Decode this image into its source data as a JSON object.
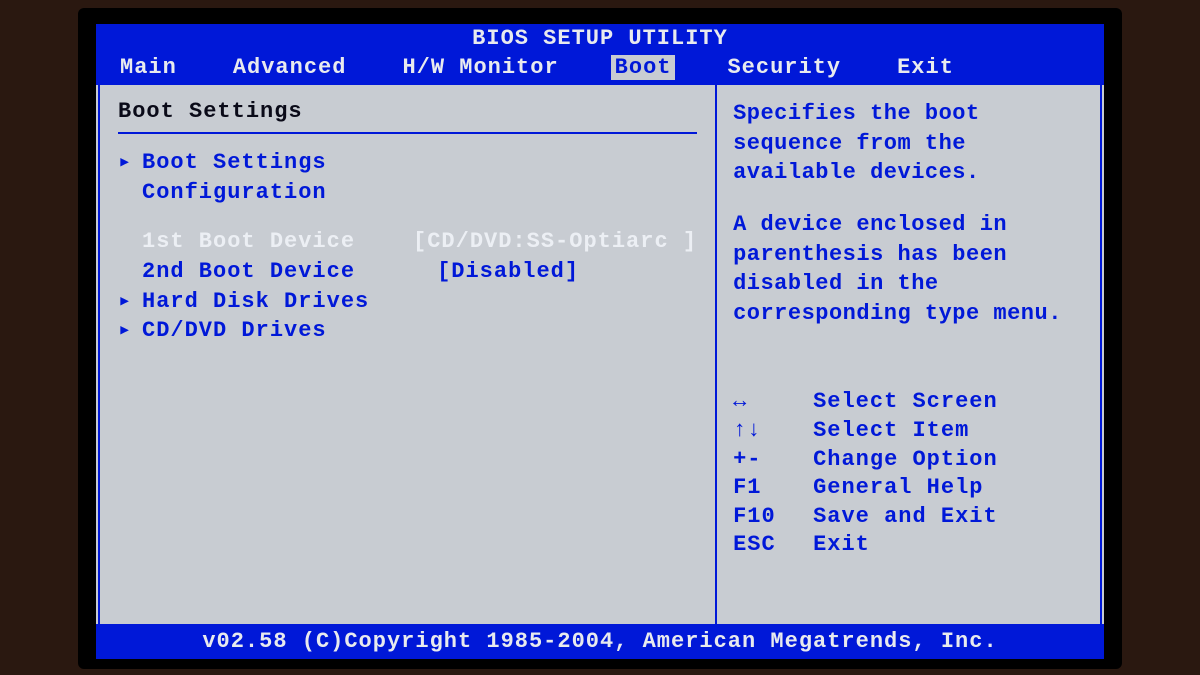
{
  "title": "BIOS SETUP UTILITY",
  "menu": {
    "items": [
      "Main",
      "Advanced",
      "H/W Monitor",
      "Boot",
      "Security",
      "Exit"
    ],
    "active_index": 3
  },
  "left": {
    "heading": "Boot Settings",
    "rows": [
      {
        "arrow": "▸",
        "label": "Boot Settings Configuration",
        "value": "",
        "selected": false
      },
      {
        "spacer": true
      },
      {
        "arrow": "",
        "label": "1st Boot Device",
        "value": "[CD/DVD:SS-Optiarc ]",
        "selected": true
      },
      {
        "arrow": "",
        "label": "2nd Boot Device",
        "value": "[Disabled]",
        "selected": false
      },
      {
        "arrow": "▸",
        "label": "Hard Disk Drives",
        "value": "",
        "selected": false
      },
      {
        "arrow": "▸",
        "label": "CD/DVD Drives",
        "value": "",
        "selected": false
      }
    ]
  },
  "right": {
    "help1": "Specifies the boot sequence from the available devices.",
    "help2": "A device enclosed in parenthesis has been disabled in the corresponding type menu.",
    "keys": [
      {
        "sym": "↔",
        "desc": "Select Screen"
      },
      {
        "sym": "↑↓",
        "desc": "Select Item"
      },
      {
        "sym": "+-",
        "desc": "Change Option"
      },
      {
        "sym": "F1",
        "desc": "General Help"
      },
      {
        "sym": "F10",
        "desc": "Save and Exit"
      },
      {
        "sym": "ESC",
        "desc": "Exit"
      }
    ]
  },
  "footer": "v02.58 (C)Copyright 1985-2004, American Megatrends, Inc."
}
